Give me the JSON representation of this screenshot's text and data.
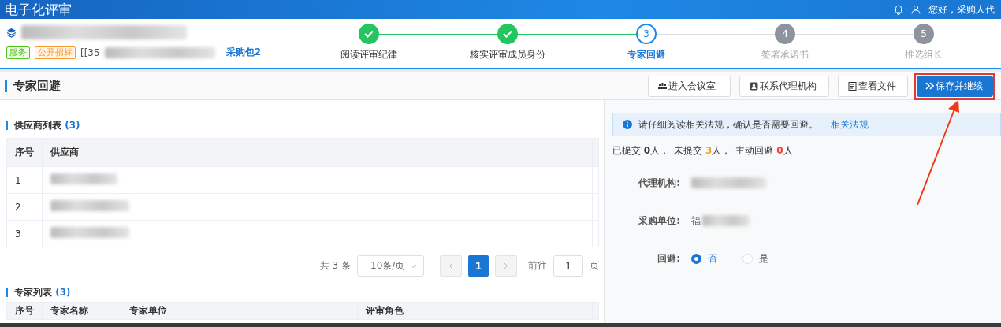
{
  "app_title": "电子化评审",
  "user": {
    "greeting": "您好，采购人代"
  },
  "project": {
    "tags": [
      {
        "label": "服务",
        "color": "#52c41a"
      },
      {
        "label": "公开招标",
        "color": "#fa9a2f"
      }
    ],
    "code": "[[35",
    "package": "采购包2"
  },
  "steps": [
    {
      "label": "阅读评审纪律",
      "done": true,
      "active": false
    },
    {
      "label": "核实评审成员身份",
      "done": true,
      "active": false
    },
    {
      "number": "3",
      "label": "专家回避",
      "done": false,
      "active": true
    },
    {
      "number": "4",
      "label": "签署承诺书",
      "done": false,
      "active": false
    },
    {
      "number": "5",
      "label": "推选组长",
      "done": false,
      "active": false
    }
  ],
  "page_title": "专家回避",
  "buttons": [
    {
      "label": "进入会议室",
      "kind": "meeting",
      "primary": false,
      "highlighted": false
    },
    {
      "label": "联系代理机构",
      "kind": "contact",
      "primary": false,
      "highlighted": false
    },
    {
      "label": "查看文件",
      "kind": "file",
      "primary": false,
      "highlighted": false
    },
    {
      "label": "保存并继续",
      "kind": "forward",
      "primary": true,
      "highlighted": true
    }
  ],
  "supplier_list": {
    "title": "供应商列表",
    "count": "(3)",
    "columns": [
      "序号",
      "供应商"
    ],
    "rows": [
      {
        "index": "1"
      },
      {
        "index": "2"
      },
      {
        "index": "3"
      }
    ]
  },
  "pagination": {
    "total": "共 3 条",
    "page_size": "10条/页",
    "pages": [
      {
        "label": "1",
        "selected": true
      }
    ],
    "goto_label": "前往",
    "goto_value": "1",
    "page_suffix": "页"
  },
  "expert_list": {
    "title": "专家列表",
    "count": "(3)",
    "columns": [
      "序号",
      "专家名称",
      "专家单位",
      "评审角色"
    ]
  },
  "notice": {
    "text": "请仔细阅读相关法规，确认是否需要回避。",
    "link": "相关法规"
  },
  "summary": [
    {
      "label": "已提交",
      "count": "0",
      "unit": "人，",
      "color": "#333333"
    },
    {
      "label": "未提交",
      "count": "3",
      "unit": "人，",
      "color": "#f5a623"
    },
    {
      "label": "主动回避",
      "count": "0",
      "unit": "人",
      "color": "#f04134"
    }
  ],
  "form": [
    {
      "label": "代理机构:",
      "kind": "text"
    },
    {
      "label": "采购单位:",
      "kind": "text",
      "value": "福"
    },
    {
      "label": "回避:",
      "kind": "radio",
      "options": [
        {
          "label": "否",
          "selected": true
        },
        {
          "label": "是",
          "selected": false
        }
      ]
    }
  ]
}
